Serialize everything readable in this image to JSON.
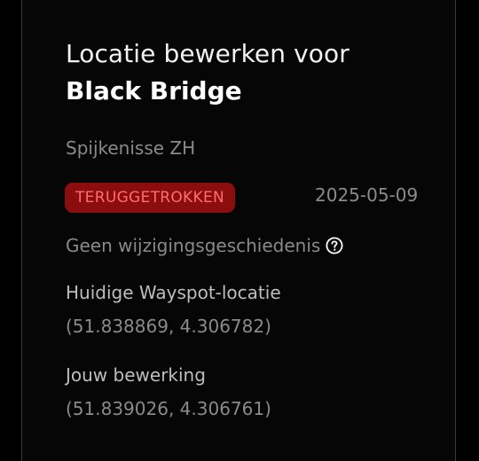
{
  "header": {
    "title_prefix": "Locatie bewerken voor",
    "wayspot_name": "Black Bridge"
  },
  "wayspot": {
    "location": "Spijkenisse ZH",
    "status": "TERUGGETROKKEN",
    "status_color": "#8c0d0d",
    "status_text_color": "#ff6d6d",
    "date": "2025-05-09",
    "history_text": "Geen wijzigingsgeschiedenis",
    "history_icon": "question-circle-icon"
  },
  "current": {
    "label": "Huidige Wayspot-locatie",
    "coords": "(51.838869, 4.306782)"
  },
  "edit": {
    "label": "Jouw bewerking",
    "coords": "(51.839026, 4.306761)"
  },
  "colors": {
    "background": "#000000",
    "panel": "#060606",
    "text_primary": "#ffffff",
    "text_secondary": "#8a8a8a"
  }
}
